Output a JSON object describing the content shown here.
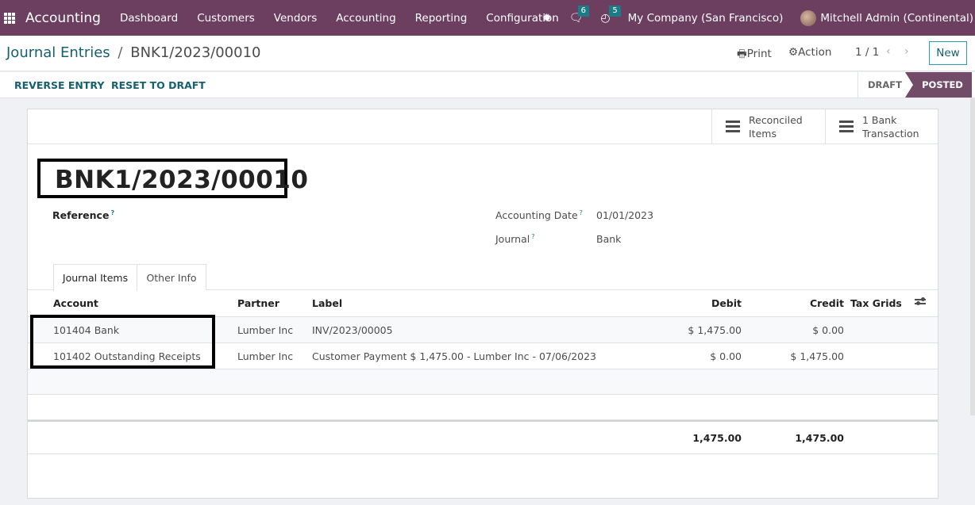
{
  "navbar": {
    "app_name": "Accounting",
    "menu": [
      "Dashboard",
      "Customers",
      "Vendors",
      "Accounting",
      "Reporting",
      "Configuration"
    ],
    "icons": {
      "apps": "grid-icon",
      "debug": "bug-icon",
      "messages": "chat-icon",
      "activities": "clock-icon"
    },
    "messages_count": "6",
    "activities_count": "5",
    "company": "My Company (San Francisco)",
    "user": "Mitchell Admin (Continental)",
    "brand_color": "#714b67"
  },
  "control_panel": {
    "breadcrumb_parent": "Journal Entries",
    "breadcrumb_separator": "/",
    "breadcrumb_current": "BNK1/2023/00010",
    "print_label": "Print",
    "action_label": "Action",
    "pager": "1 / 1",
    "new_label": "New"
  },
  "status_bar": {
    "buttons": [
      "REVERSE ENTRY",
      "RESET TO DRAFT"
    ],
    "stages": [
      "DRAFT",
      "POSTED"
    ],
    "current_stage": "POSTED"
  },
  "smart_buttons": [
    {
      "line1": "Reconciled",
      "line2": "Items",
      "icon": "list-icon"
    },
    {
      "line1": "1 Bank",
      "line2": "Transaction",
      "icon": "list-icon"
    }
  ],
  "record": {
    "title": "BNK1/2023/00010",
    "reference_label": "Reference",
    "reference_value": "",
    "accounting_date_label": "Accounting Date",
    "accounting_date": "01/01/2023",
    "journal_label": "Journal",
    "journal": "Bank",
    "help_mark": "?"
  },
  "tabs": [
    "Journal Items",
    "Other Info"
  ],
  "active_tab": "Journal Items",
  "journal_items": {
    "columns": [
      "Account",
      "Partner",
      "Label",
      "Debit",
      "Credit",
      "Tax Grids"
    ],
    "rows": [
      {
        "account": "101404 Bank",
        "partner": "Lumber Inc",
        "label": "INV/2023/00005",
        "debit": "$ 1,475.00",
        "credit": "$ 0.00",
        "tax_grids": ""
      },
      {
        "account": "101402 Outstanding Receipts",
        "partner": "Lumber Inc",
        "label": "Customer Payment $ 1,475.00 - Lumber Inc - 07/06/2023",
        "debit": "$ 0.00",
        "credit": "$ 1,475.00",
        "tax_grids": ""
      }
    ],
    "total_debit": "1,475.00",
    "total_credit": "1,475.00"
  }
}
